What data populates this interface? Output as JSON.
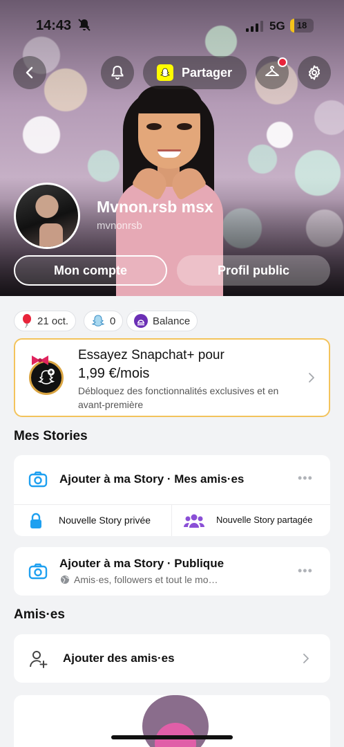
{
  "status": {
    "time": "14:43",
    "network": "5G",
    "battery": "18",
    "battery_level": 0.18
  },
  "top_bar": {
    "share_label": "Partager"
  },
  "profile": {
    "display_name": "Mvnon.rsb msx",
    "username": "mvnonrsb",
    "my_account_label": "Mon compte",
    "public_profile_label": "Profil public"
  },
  "chips": {
    "birthday": "21 oct.",
    "score": "0",
    "balance": "Balance"
  },
  "plus": {
    "title_line1": "Essayez Snapchat+ pour",
    "title_line2": "1,99 €/mois",
    "subtitle": "Débloquez des fonctionnalités exclusives et en avant-première"
  },
  "stories": {
    "section_title": "Mes Stories",
    "add_friends_story": "Ajouter à ma Story · Mes amis·es",
    "new_private": "Nouvelle Story privée",
    "new_shared": "Nouvelle Story partagée",
    "add_public_story": "Ajouter à ma Story · Publique",
    "public_sub": "Amis·es, followers et tout le mo…"
  },
  "friends": {
    "section_title": "Amis·es",
    "add_friends": "Ajouter des amis·es"
  },
  "colors": {
    "snap_yellow": "#fffc00",
    "accent_blue": "#1ea0f0",
    "purple": "#8a4fd6",
    "gold_border": "#f3c35b"
  },
  "icons": [
    "back-icon",
    "bell-icon",
    "snapcode-icon",
    "hanger-icon",
    "gear-icon",
    "balloon-icon",
    "ghost-icon",
    "balance-icon",
    "camera-icon",
    "lock-icon",
    "group-icon",
    "globe-icon",
    "add-friend-icon",
    "chevron-right-icon",
    "more-icon"
  ]
}
